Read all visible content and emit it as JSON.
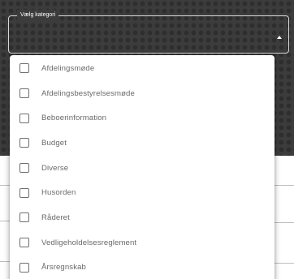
{
  "select": {
    "label": "Vælg kategori",
    "expanded": true
  },
  "menu": {
    "items": [
      {
        "label": "Afdelingsmøde",
        "checked": false
      },
      {
        "label": "Afdelingsbestyrelsesmøde",
        "checked": false
      },
      {
        "label": "Beboerinformation",
        "checked": false
      },
      {
        "label": "Budget",
        "checked": false
      },
      {
        "label": "Diverse",
        "checked": false
      },
      {
        "label": "Husorden",
        "checked": false
      },
      {
        "label": "Råderet",
        "checked": false
      },
      {
        "label": "Vedligeholdelsesreglement",
        "checked": false
      },
      {
        "label": "Årsregnskab",
        "checked": false
      }
    ]
  },
  "colors": {
    "backdrop": "#3c3c3c",
    "checkbox_border": "#6f6f6f",
    "item_text": "#6a6a6a"
  },
  "icons": {
    "select_arrow": "arrow-up-icon",
    "item_checkbox": "checkbox-unchecked-icon"
  }
}
